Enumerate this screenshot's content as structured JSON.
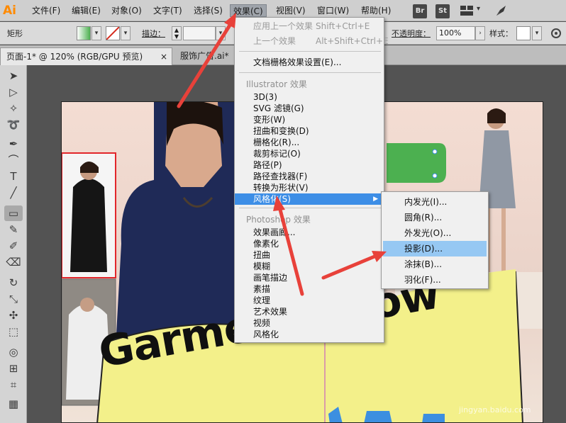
{
  "menubar": {
    "logo": "Ai",
    "items": [
      "文件(F)",
      "编辑(E)",
      "对象(O)",
      "文字(T)",
      "选择(S)",
      "效果(C)",
      "视图(V)",
      "窗口(W)",
      "帮助(H)"
    ],
    "app_icons": [
      "Br",
      "St"
    ]
  },
  "controlbar": {
    "object_type": "矩形",
    "stroke_label": "描边：",
    "opacity_label": "不透明度：",
    "opacity_value": "100%",
    "style_label": "样式："
  },
  "tabs": [
    {
      "label": "页面-1* @ 120% (RGB/GPU 预览)",
      "close": "×"
    },
    {
      "label": "服饰广告.ai*",
      "close": "×"
    }
  ],
  "effect_menu": {
    "top_items": [
      {
        "label": "应用上一个效果",
        "shortcut": "Shift+Ctrl+E",
        "disabled": true
      },
      {
        "label": "上一个效果",
        "shortcut": "Alt+Shift+Ctrl+E",
        "disabled": true
      }
    ],
    "raster_settings": "文档栅格效果设置(E)...",
    "illustrator_header": "Illustrator 效果",
    "illustrator_items": [
      "3D(3)",
      "SVG 滤镜(G)",
      "变形(W)",
      "扭曲和变换(D)",
      "栅格化(R)...",
      "裁剪标记(O)",
      "路径(P)",
      "路径查找器(F)",
      "转换为形状(V)",
      "风格化(S)"
    ],
    "photoshop_header": "Photoshop 效果",
    "photoshop_items": [
      "效果画廊...",
      "像素化",
      "扭曲",
      "模糊",
      "画笔描边",
      "素描",
      "纹理",
      "艺术效果",
      "视频",
      "风格化"
    ]
  },
  "stylize_submenu": [
    "内发光(I)...",
    "圆角(R)...",
    "外发光(O)...",
    "投影(D)...",
    "涂抹(B)...",
    "羽化(F)..."
  ],
  "artwork": {
    "headline": "Garment Show",
    "watermark": "jingyan.baidu.com"
  },
  "colors": {
    "menu_highlight": "#3d8ee6",
    "submenu_highlight": "#96c8f3",
    "arrow": "#e8413a",
    "banner": "#f3f08a",
    "green_shape": "#4cb050"
  }
}
